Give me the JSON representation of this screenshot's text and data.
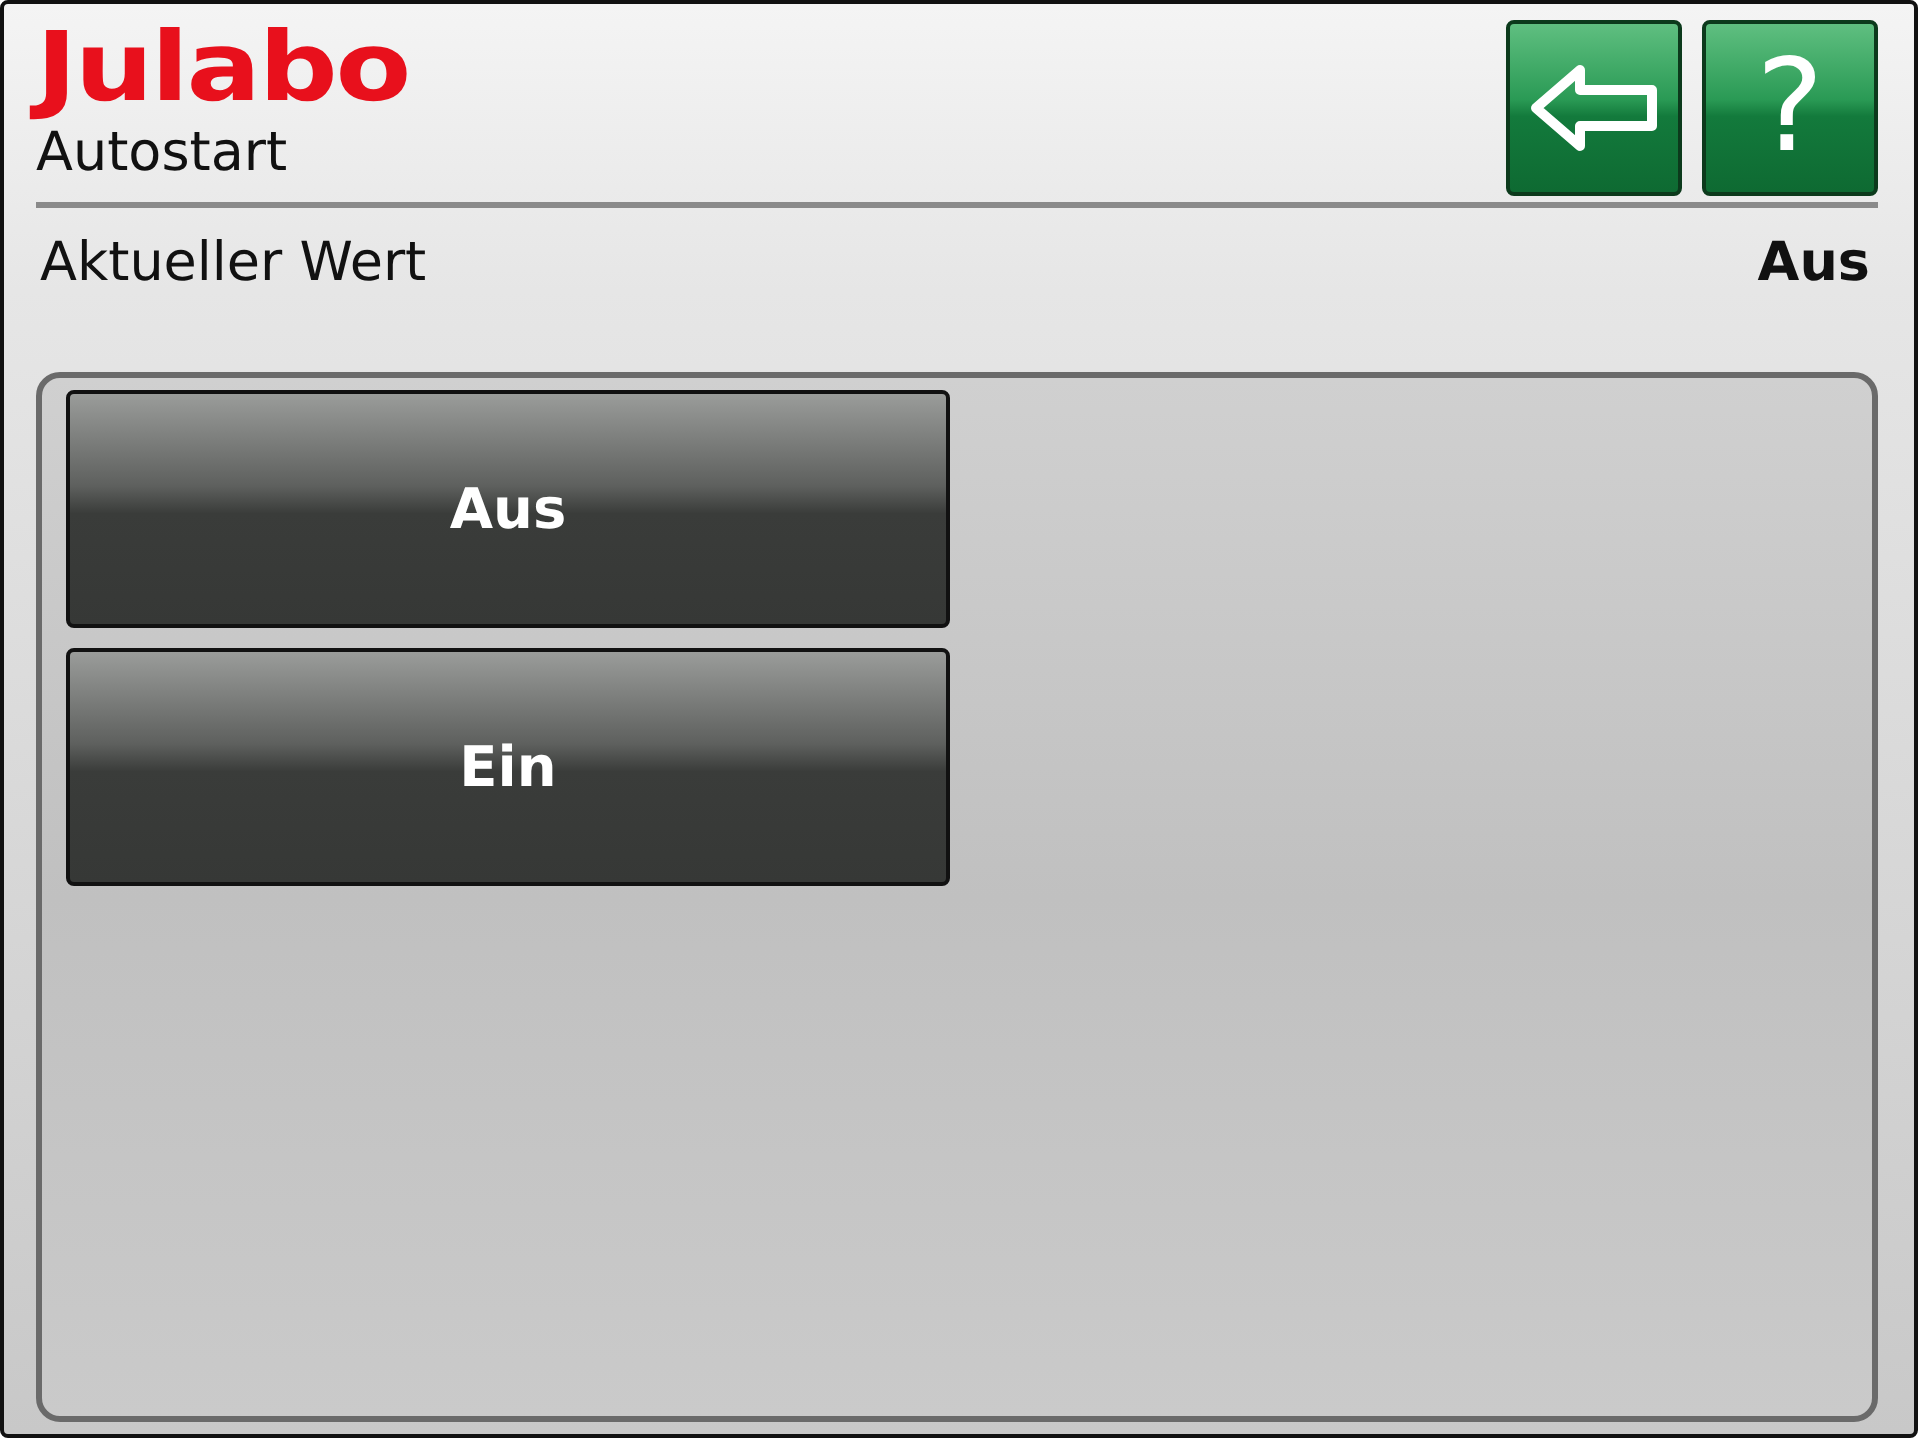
{
  "header": {
    "logo": "Julabo",
    "title": "Autostart",
    "help_button": "?"
  },
  "current_value": {
    "label": "Aktueller Wert",
    "value": "Aus"
  },
  "options": [
    {
      "label": "Aus"
    },
    {
      "label": "Ein"
    }
  ]
}
